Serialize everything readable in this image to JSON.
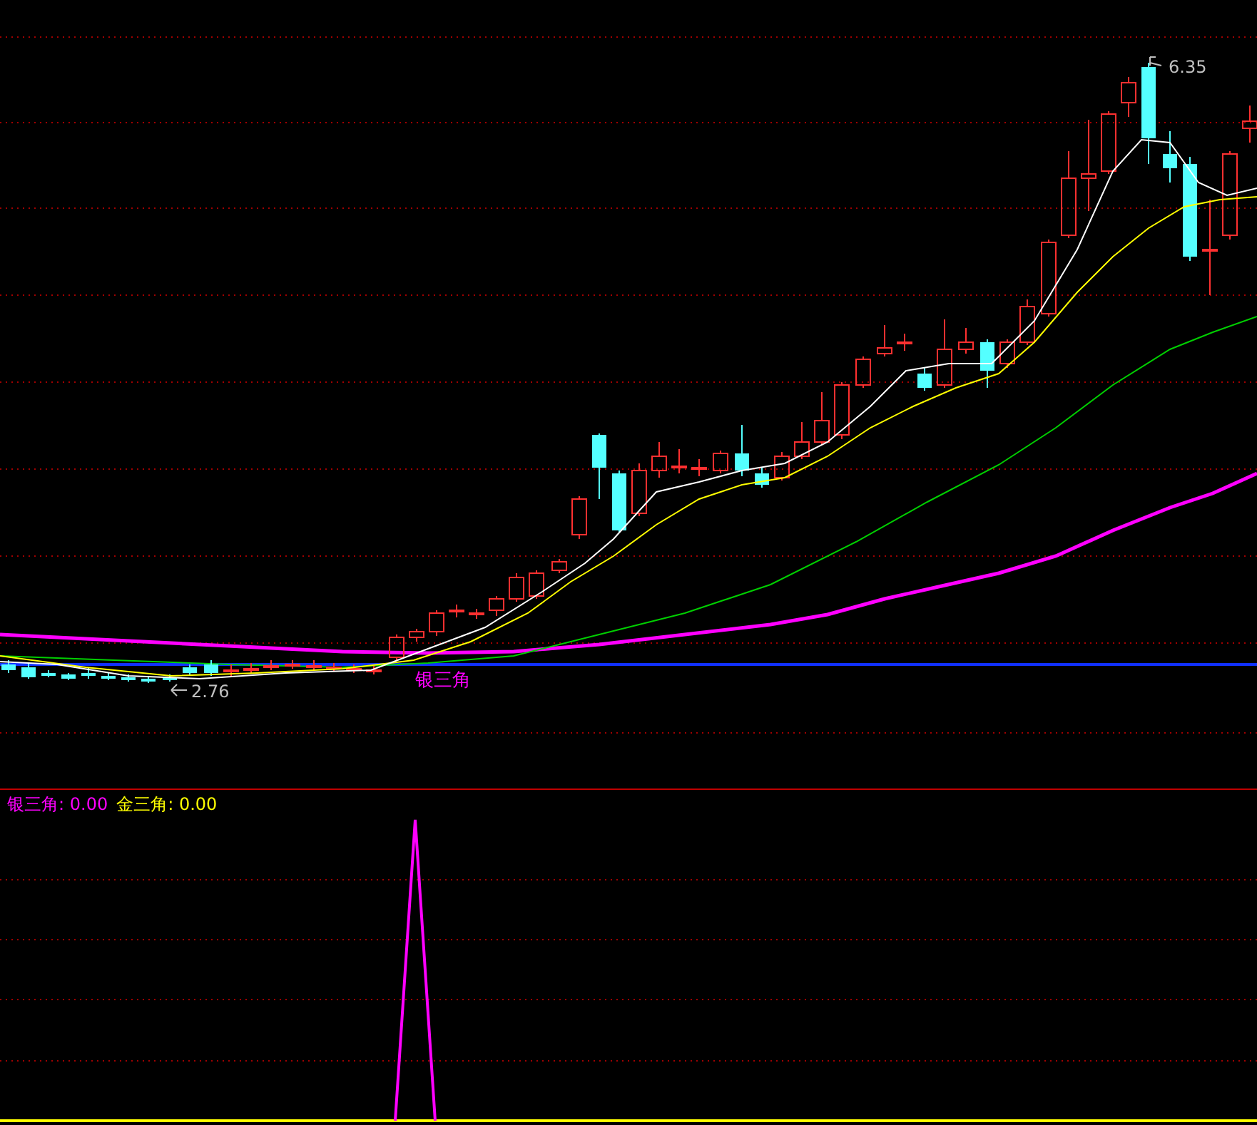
{
  "main_panel": {
    "high_label": "6.35",
    "low_label": "2.76",
    "signal_label": "银三角"
  },
  "indicator_panel": {
    "legend": [
      {
        "name": "银三角:",
        "value": "0.00",
        "color": "#ff00ff"
      },
      {
        "name": "金三角:",
        "value": "0.00",
        "color": "#ffff00"
      }
    ]
  }
}
